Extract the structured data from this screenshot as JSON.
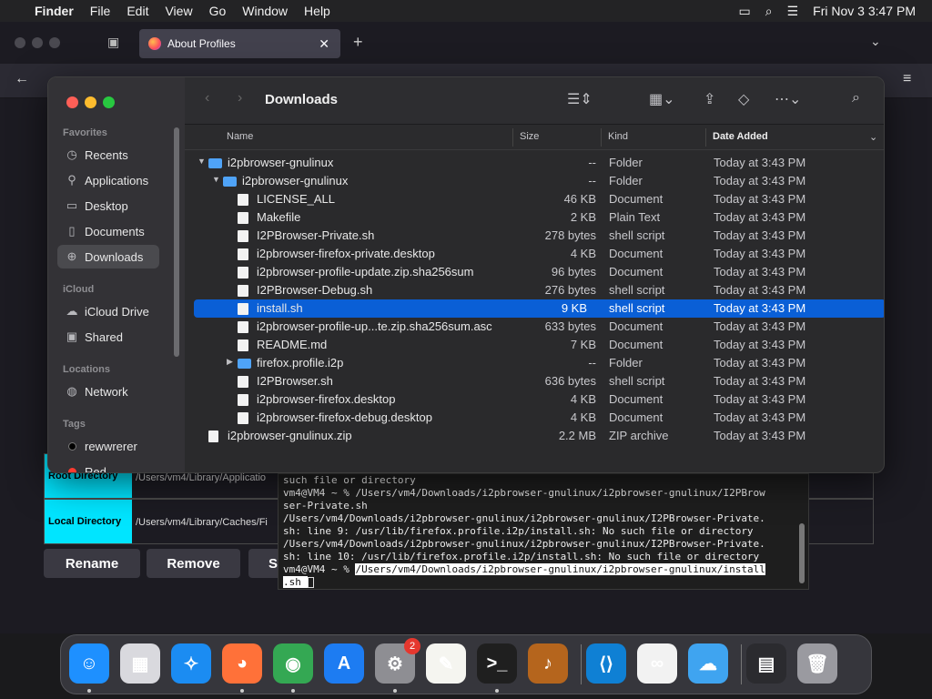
{
  "menubar": {
    "app": "Finder",
    "items": [
      "File",
      "Edit",
      "View",
      "Go",
      "Window",
      "Help"
    ],
    "clock": "Fri Nov 3  3:47 PM"
  },
  "firefox": {
    "tab_title": "About Profiles",
    "buttons": {
      "rename": "Rename",
      "remove": "Remove",
      "set_default_partial": "S"
    },
    "dirs": {
      "root_label": "Root Directory",
      "root_value": "/Users/vm4/Library/Applicatio",
      "local_label": "Local Directory",
      "local_value": "/Users/vm4/Library/Caches/Fi"
    }
  },
  "terminal": {
    "lines": [
      "such file or directory",
      "vm4@VM4 ~ % /Users/vm4/Downloads/i2pbrowser-gnulinux/i2pbrowser-gnulinux/I2PBrow",
      "ser-Private.sh",
      "/Users/vm4/Downloads/i2pbrowser-gnulinux/i2pbrowser-gnulinux/I2PBrowser-Private.",
      "sh: line 9: /usr/lib/firefox.profile.i2p/install.sh: No such file or directory",
      "/Users/vm4/Downloads/i2pbrowser-gnulinux/i2pbrowser-gnulinux/I2PBrowser-Private.",
      "sh: line 10: /usr/lib/firefox.profile.i2p/install.sh: No such file or directory"
    ],
    "prompt": "vm4@VM4 ~ % ",
    "typed_line1": "/Users/vm4/Downloads/i2pbrowser-gnulinux/i2pbrowser-gnulinux/install",
    "typed_line2": ".sh "
  },
  "finder": {
    "title": "Downloads",
    "sidebar": {
      "favorites_label": "Favorites",
      "favorites": [
        {
          "label": "Recents",
          "icon": "clock-icon"
        },
        {
          "label": "Applications",
          "icon": "applications-icon"
        },
        {
          "label": "Desktop",
          "icon": "desktop-icon"
        },
        {
          "label": "Documents",
          "icon": "document-icon"
        },
        {
          "label": "Downloads",
          "icon": "download-icon",
          "selected": true
        }
      ],
      "icloud_label": "iCloud",
      "icloud": [
        {
          "label": "iCloud Drive",
          "icon": "cloud-icon"
        },
        {
          "label": "Shared",
          "icon": "shared-folder-icon"
        }
      ],
      "locations_label": "Locations",
      "locations": [
        {
          "label": "Network",
          "icon": "globe-icon"
        }
      ],
      "tags_label": "Tags",
      "tags": [
        {
          "label": "rewwrerer",
          "color": "#000000"
        },
        {
          "label": "Red",
          "color": "#ff3b30"
        }
      ]
    },
    "columns": {
      "name": "Name",
      "size": "Size",
      "kind": "Kind",
      "date": "Date Added"
    },
    "rows": [
      {
        "name": "i2pbrowser-gnulinux",
        "size": "--",
        "kind": "Folder",
        "date": "Today at 3:43 PM",
        "level": 0,
        "type": "folder",
        "disclosure": "expanded"
      },
      {
        "name": "i2pbrowser-gnulinux",
        "size": "--",
        "kind": "Folder",
        "date": "Today at 3:43 PM",
        "level": 1,
        "type": "folder",
        "disclosure": "expanded"
      },
      {
        "name": "LICENSE_ALL",
        "size": "46 KB",
        "kind": "Document",
        "date": "Today at 3:43 PM",
        "level": 2,
        "type": "doc"
      },
      {
        "name": "Makefile",
        "size": "2 KB",
        "kind": "Plain Text",
        "date": "Today at 3:43 PM",
        "level": 2,
        "type": "doc"
      },
      {
        "name": "I2PBrowser-Private.sh",
        "size": "278 bytes",
        "kind": "shell script",
        "date": "Today at 3:43 PM",
        "level": 2,
        "type": "doc"
      },
      {
        "name": "i2pbrowser-firefox-private.desktop",
        "size": "4 KB",
        "kind": "Document",
        "date": "Today at 3:43 PM",
        "level": 2,
        "type": "doc"
      },
      {
        "name": "i2pbrowser-profile-update.zip.sha256sum",
        "size": "96 bytes",
        "kind": "Document",
        "date": "Today at 3:43 PM",
        "level": 2,
        "type": "doc"
      },
      {
        "name": "I2PBrowser-Debug.sh",
        "size": "276 bytes",
        "kind": "shell script",
        "date": "Today at 3:43 PM",
        "level": 2,
        "type": "doc"
      },
      {
        "name": "install.sh",
        "size": "9 KB",
        "kind": "shell script",
        "date": "Today at 3:43 PM",
        "level": 2,
        "type": "doc",
        "selected": true
      },
      {
        "name": "i2pbrowser-profile-up...te.zip.sha256sum.asc",
        "size": "633 bytes",
        "kind": "Document",
        "date": "Today at 3:43 PM",
        "level": 2,
        "type": "doc"
      },
      {
        "name": "README.md",
        "size": "7 KB",
        "kind": "Document",
        "date": "Today at 3:43 PM",
        "level": 2,
        "type": "doc"
      },
      {
        "name": "firefox.profile.i2p",
        "size": "--",
        "kind": "Folder",
        "date": "Today at 3:43 PM",
        "level": 2,
        "type": "folder",
        "disclosure": "collapsed"
      },
      {
        "name": "I2PBrowser.sh",
        "size": "636 bytes",
        "kind": "shell script",
        "date": "Today at 3:43 PM",
        "level": 2,
        "type": "doc"
      },
      {
        "name": "i2pbrowser-firefox.desktop",
        "size": "4 KB",
        "kind": "Document",
        "date": "Today at 3:43 PM",
        "level": 2,
        "type": "doc"
      },
      {
        "name": "i2pbrowser-firefox-debug.desktop",
        "size": "4 KB",
        "kind": "Document",
        "date": "Today at 3:43 PM",
        "level": 2,
        "type": "doc"
      },
      {
        "name": "i2pbrowser-gnulinux.zip",
        "size": "2.2 MB",
        "kind": "ZIP archive",
        "date": "Today at 3:43 PM",
        "level": 0,
        "type": "zip"
      }
    ]
  },
  "dock": {
    "apps": [
      {
        "name": "Finder",
        "icon": "finder-icon",
        "color": "#1e90ff",
        "glyph": "☺",
        "running": true
      },
      {
        "name": "Launchpad",
        "icon": "launchpad-icon",
        "color": "#d9d9de",
        "glyph": "▦",
        "running": false
      },
      {
        "name": "Safari",
        "icon": "safari-icon",
        "color": "#1b8cf2",
        "glyph": "✧",
        "running": false
      },
      {
        "name": "Firefox",
        "icon": "firefox-icon",
        "color": "#ff7139",
        "glyph": "◕",
        "running": true
      },
      {
        "name": "Chrome",
        "icon": "chrome-icon",
        "color": "#34a853",
        "glyph": "◉",
        "running": true
      },
      {
        "name": "App Store",
        "icon": "app-store-icon",
        "color": "#1d7cf2",
        "glyph": "A",
        "running": false
      },
      {
        "name": "System Settings",
        "icon": "settings-icon",
        "color": "#8e8e93",
        "glyph": "⚙",
        "running": true,
        "badge": "2"
      },
      {
        "name": "TextEdit",
        "icon": "textedit-icon",
        "color": "#f5f5f0",
        "glyph": "✎",
        "running": false
      },
      {
        "name": "Terminal",
        "icon": "terminal-icon",
        "color": "#1f1f1f",
        "glyph": ">_",
        "running": true
      },
      {
        "name": "Instruments",
        "icon": "instruments-icon",
        "color": "#b5651d",
        "glyph": "♪",
        "running": false
      },
      {
        "name": "VS Code",
        "icon": "vscode-icon",
        "color": "#0f80d4",
        "glyph": "⟨⟩",
        "running": false
      },
      {
        "name": "Visual Studio",
        "icon": "visual-studio-icon",
        "color": "#f2f2f2",
        "glyph": "∞",
        "running": false
      },
      {
        "name": "Weather",
        "icon": "weather-icon",
        "color": "#3fa4f0",
        "glyph": "☁",
        "running": false
      },
      {
        "name": "Downloads Stack",
        "icon": "stack-icon",
        "color": "#2b2b2f",
        "glyph": "▤",
        "running": false
      },
      {
        "name": "Trash",
        "icon": "trash-icon",
        "color": "#9a9aa0",
        "glyph": "🗑",
        "running": false
      }
    ]
  }
}
